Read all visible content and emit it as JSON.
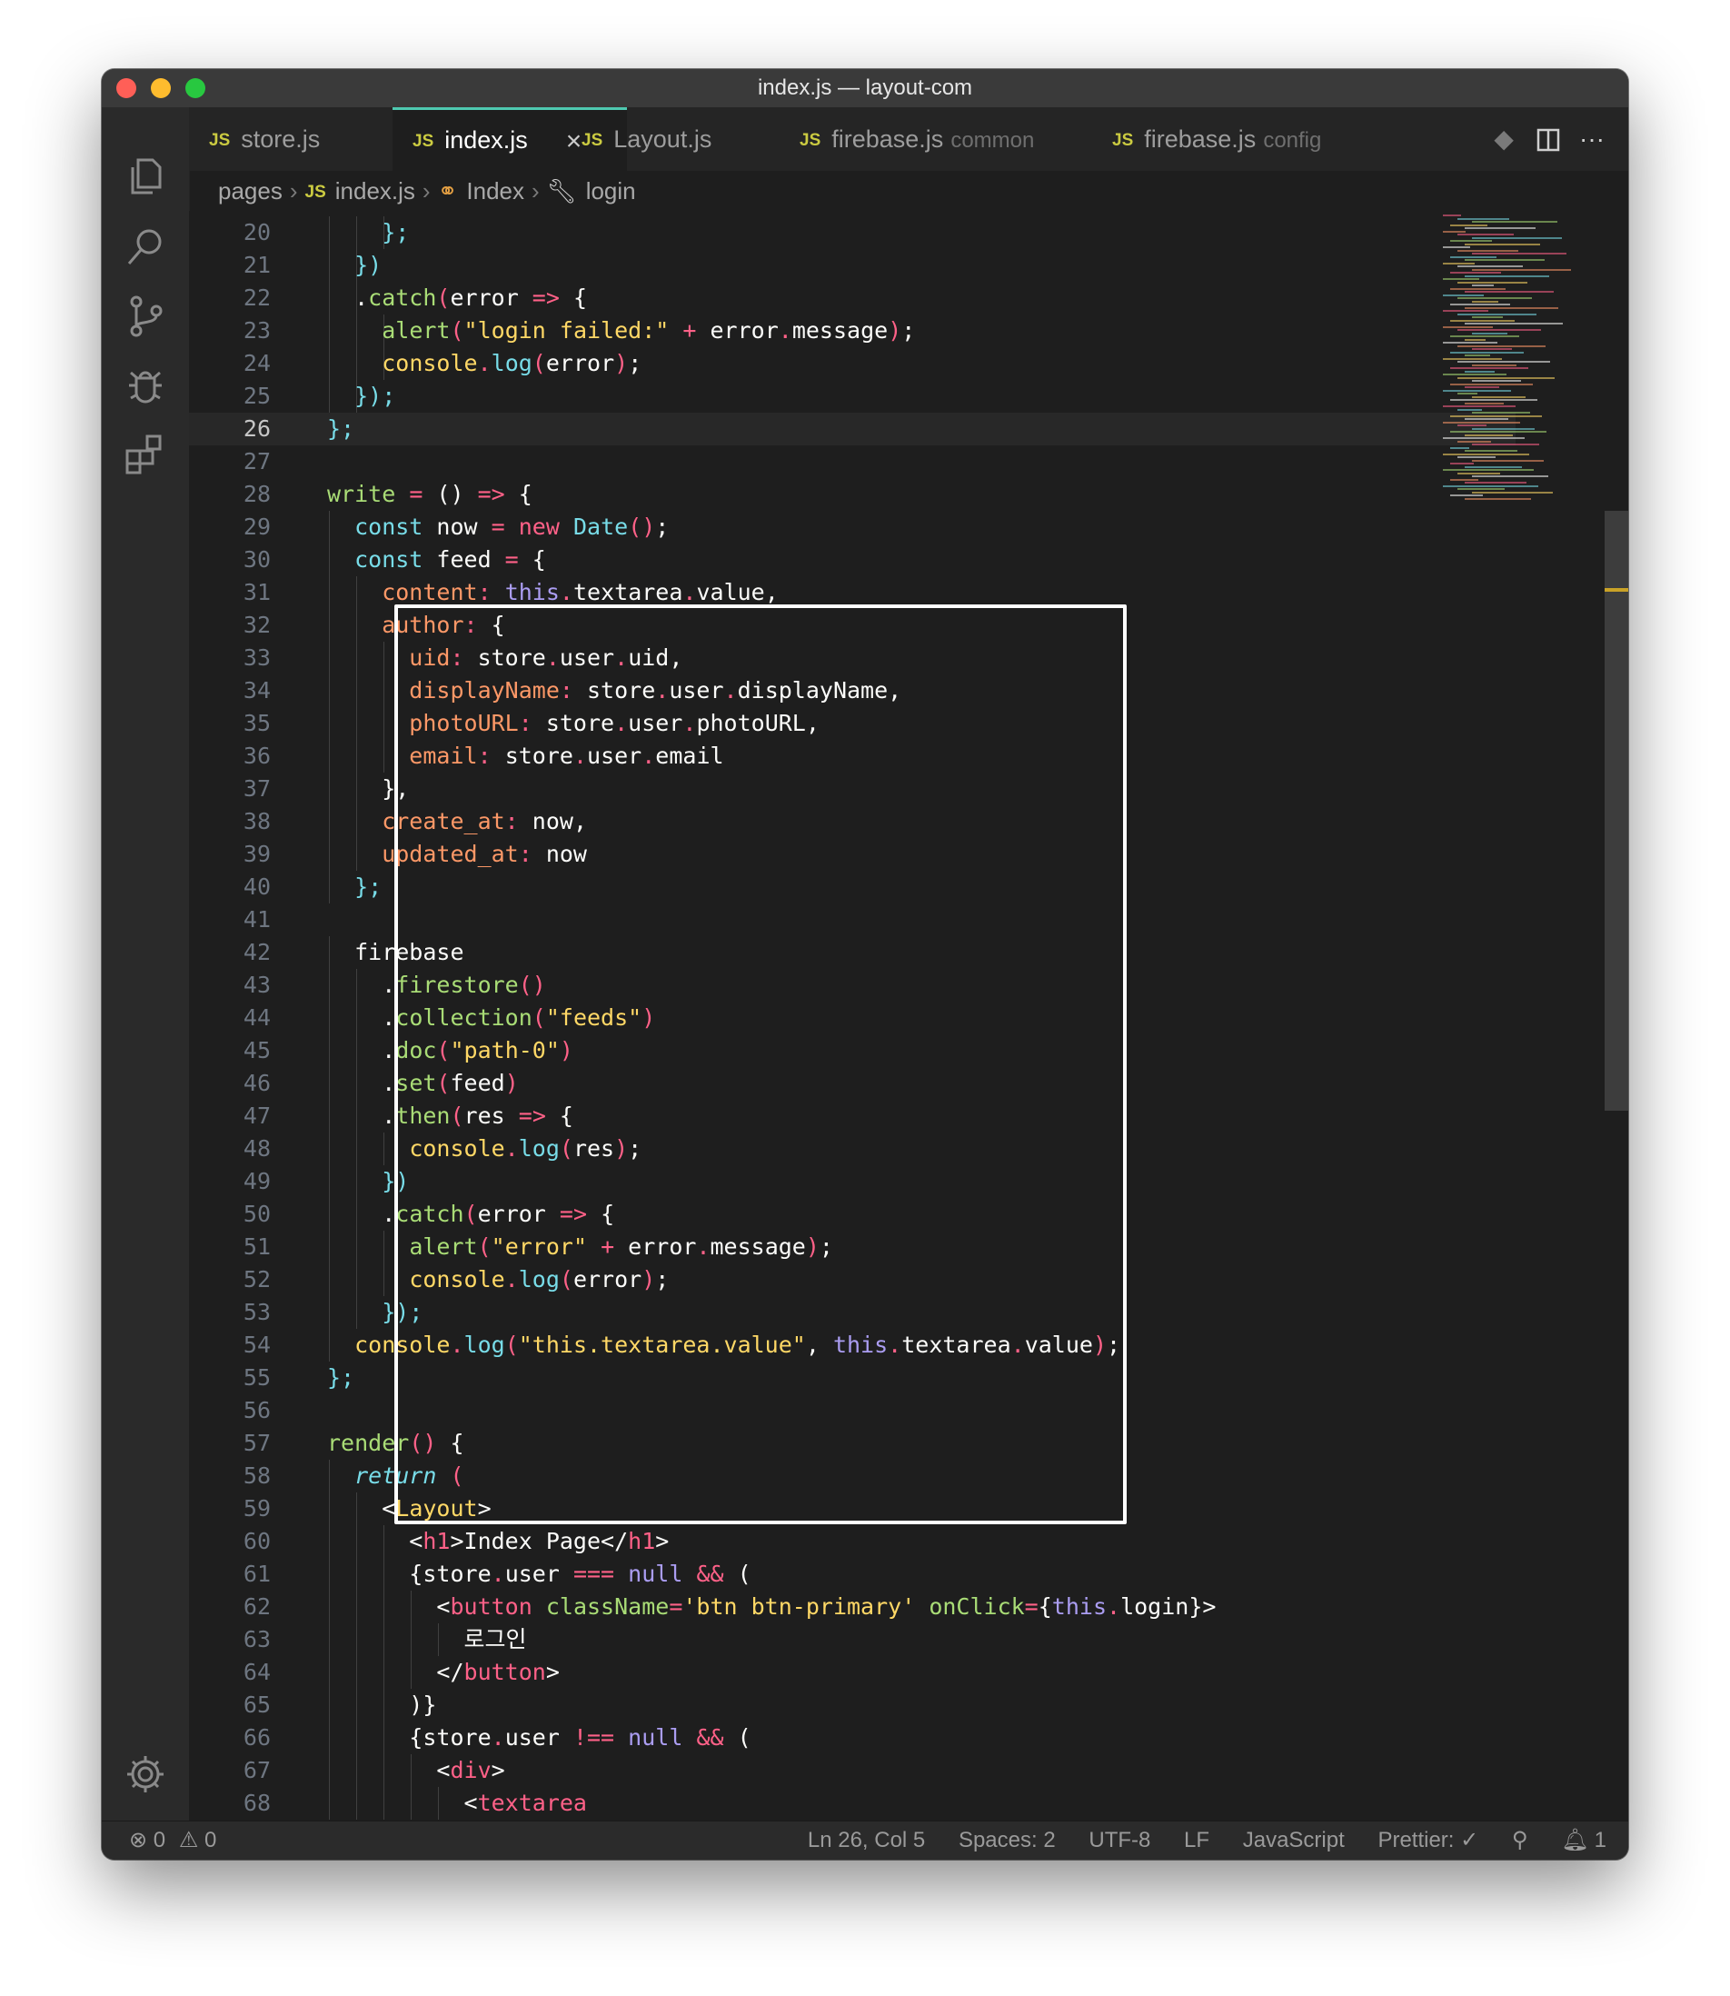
{
  "window": {
    "title": "index.js — layout-com"
  },
  "activity_bar": {
    "items": [
      "explorer-icon",
      "search-icon",
      "source-control-icon",
      "debug-icon",
      "extensions-icon"
    ],
    "bottom": "gear-icon"
  },
  "tabs": [
    {
      "badge": "JS",
      "label": "store.js",
      "desc": "",
      "active": false
    },
    {
      "badge": "JS",
      "label": "index.js",
      "desc": "",
      "active": true,
      "close": "×"
    },
    {
      "badge": "JS",
      "label": "Layout.js",
      "desc": "",
      "active": false
    },
    {
      "badge": "JS",
      "label": "firebase.js",
      "desc": "common",
      "active": false
    },
    {
      "badge": "JS",
      "label": "firebase.js",
      "desc": "config",
      "active": false
    }
  ],
  "tab_actions": [
    "source-diff-icon",
    "split-editor-icon",
    "more-actions-icon"
  ],
  "breadcrumb": {
    "folder": "pages",
    "file_badge": "JS",
    "file": "index.js",
    "class": "Index",
    "method": "login"
  },
  "editor": {
    "current_line": 26,
    "lines": [
      {
        "n": "20",
        "indent": 3,
        "t": [
          [
            "p",
            "    "
          ],
          [
            "k",
            "};"
          ]
        ]
      },
      {
        "n": "21",
        "indent": 2,
        "t": [
          [
            "k",
            "  })"
          ]
        ]
      },
      {
        "n": "22",
        "indent": 2,
        "t": [
          [
            "w",
            "  ."
          ],
          [
            "g",
            "catch"
          ],
          [
            "p",
            "("
          ],
          [
            "w",
            "error "
          ],
          [
            "p",
            "=>"
          ],
          [
            "w",
            " {"
          ]
        ]
      },
      {
        "n": "23",
        "indent": 3,
        "t": [
          [
            "w",
            "    "
          ],
          [
            "g",
            "alert"
          ],
          [
            "p",
            "("
          ],
          [
            "y",
            "\"login failed:\""
          ],
          [
            "w",
            " "
          ],
          [
            "p",
            "+"
          ],
          [
            "w",
            " error"
          ],
          [
            "p",
            "."
          ],
          [
            "w",
            "message"
          ],
          [
            "p",
            ")"
          ],
          [
            "w",
            ";"
          ]
        ]
      },
      {
        "n": "24",
        "indent": 3,
        "t": [
          [
            "w",
            "    "
          ],
          [
            "y",
            "console"
          ],
          [
            "p",
            "."
          ],
          [
            "k",
            "log"
          ],
          [
            "p",
            "("
          ],
          [
            "w",
            "error"
          ],
          [
            "p",
            ")"
          ],
          [
            "w",
            ";"
          ]
        ]
      },
      {
        "n": "25",
        "indent": 2,
        "t": [
          [
            "k",
            "  });"
          ]
        ]
      },
      {
        "n": "26",
        "indent": 0,
        "t": [
          [
            "k",
            "};"
          ]
        ]
      },
      {
        "n": "27",
        "indent": 0,
        "t": []
      },
      {
        "n": "28",
        "indent": 0,
        "t": [
          [
            "g",
            "write"
          ],
          [
            "w",
            " "
          ],
          [
            "p",
            "="
          ],
          [
            "w",
            " () "
          ],
          [
            "p",
            "=>"
          ],
          [
            "w",
            " {"
          ]
        ]
      },
      {
        "n": "29",
        "indent": 1,
        "t": [
          [
            "k",
            "  const"
          ],
          [
            "w",
            " now "
          ],
          [
            "p",
            "="
          ],
          [
            "w",
            " "
          ],
          [
            "p",
            "new"
          ],
          [
            "w",
            " "
          ],
          [
            "k",
            "Date"
          ],
          [
            "p",
            "()"
          ],
          [
            "w",
            ";"
          ]
        ]
      },
      {
        "n": "30",
        "indent": 1,
        "t": [
          [
            "k",
            "  const"
          ],
          [
            "w",
            " feed "
          ],
          [
            "p",
            "="
          ],
          [
            "w",
            " {"
          ]
        ]
      },
      {
        "n": "31",
        "indent": 2,
        "t": [
          [
            "o",
            "    content"
          ],
          [
            "p",
            ":"
          ],
          [
            "w",
            " "
          ],
          [
            "pl",
            "this"
          ],
          [
            "p",
            "."
          ],
          [
            "w",
            "textarea"
          ],
          [
            "p",
            "."
          ],
          [
            "w",
            "value,"
          ]
        ]
      },
      {
        "n": "32",
        "indent": 2,
        "t": [
          [
            "o",
            "    author"
          ],
          [
            "p",
            ":"
          ],
          [
            "w",
            " {"
          ]
        ]
      },
      {
        "n": "33",
        "indent": 3,
        "t": [
          [
            "o",
            "      uid"
          ],
          [
            "p",
            ":"
          ],
          [
            "w",
            " store"
          ],
          [
            "p",
            "."
          ],
          [
            "w",
            "user"
          ],
          [
            "p",
            "."
          ],
          [
            "w",
            "uid,"
          ]
        ]
      },
      {
        "n": "34",
        "indent": 3,
        "t": [
          [
            "o",
            "      displayName"
          ],
          [
            "p",
            ":"
          ],
          [
            "w",
            " store"
          ],
          [
            "p",
            "."
          ],
          [
            "w",
            "user"
          ],
          [
            "p",
            "."
          ],
          [
            "w",
            "displayName,"
          ]
        ]
      },
      {
        "n": "35",
        "indent": 3,
        "t": [
          [
            "o",
            "      photoURL"
          ],
          [
            "p",
            ":"
          ],
          [
            "w",
            " store"
          ],
          [
            "p",
            "."
          ],
          [
            "w",
            "user"
          ],
          [
            "p",
            "."
          ],
          [
            "w",
            "photoURL,"
          ]
        ]
      },
      {
        "n": "36",
        "indent": 3,
        "t": [
          [
            "o",
            "      email"
          ],
          [
            "p",
            ":"
          ],
          [
            "w",
            " store"
          ],
          [
            "p",
            "."
          ],
          [
            "w",
            "user"
          ],
          [
            "p",
            "."
          ],
          [
            "w",
            "email"
          ]
        ]
      },
      {
        "n": "37",
        "indent": 2,
        "t": [
          [
            "w",
            "    },"
          ]
        ]
      },
      {
        "n": "38",
        "indent": 2,
        "t": [
          [
            "o",
            "    create_at"
          ],
          [
            "p",
            ":"
          ],
          [
            "w",
            " now,"
          ]
        ]
      },
      {
        "n": "39",
        "indent": 2,
        "t": [
          [
            "o",
            "    updated_at"
          ],
          [
            "p",
            ":"
          ],
          [
            "w",
            " now"
          ]
        ]
      },
      {
        "n": "40",
        "indent": 1,
        "t": [
          [
            "k",
            "  };"
          ]
        ]
      },
      {
        "n": "41",
        "indent": 0,
        "t": []
      },
      {
        "n": "42",
        "indent": 1,
        "t": [
          [
            "w",
            "  firebase"
          ]
        ]
      },
      {
        "n": "43",
        "indent": 2,
        "t": [
          [
            "w",
            "    ."
          ],
          [
            "g",
            "firestore"
          ],
          [
            "p",
            "()"
          ]
        ]
      },
      {
        "n": "44",
        "indent": 2,
        "t": [
          [
            "w",
            "    ."
          ],
          [
            "g",
            "collection"
          ],
          [
            "p",
            "("
          ],
          [
            "y",
            "\"feeds\""
          ],
          [
            "p",
            ")"
          ]
        ]
      },
      {
        "n": "45",
        "indent": 2,
        "t": [
          [
            "w",
            "    ."
          ],
          [
            "g",
            "doc"
          ],
          [
            "p",
            "("
          ],
          [
            "y",
            "\"path-0\""
          ],
          [
            "p",
            ")"
          ]
        ]
      },
      {
        "n": "46",
        "indent": 2,
        "t": [
          [
            "w",
            "    ."
          ],
          [
            "g",
            "set"
          ],
          [
            "p",
            "("
          ],
          [
            "w",
            "feed"
          ],
          [
            "p",
            ")"
          ]
        ]
      },
      {
        "n": "47",
        "indent": 2,
        "t": [
          [
            "w",
            "    ."
          ],
          [
            "g",
            "then"
          ],
          [
            "p",
            "("
          ],
          [
            "w",
            "res "
          ],
          [
            "p",
            "=>"
          ],
          [
            "w",
            " {"
          ]
        ]
      },
      {
        "n": "48",
        "indent": 3,
        "t": [
          [
            "w",
            "      "
          ],
          [
            "y",
            "console"
          ],
          [
            "p",
            "."
          ],
          [
            "k",
            "log"
          ],
          [
            "p",
            "("
          ],
          [
            "w",
            "res"
          ],
          [
            "p",
            ")"
          ],
          [
            "w",
            ";"
          ]
        ]
      },
      {
        "n": "49",
        "indent": 2,
        "t": [
          [
            "k",
            "    })"
          ]
        ]
      },
      {
        "n": "50",
        "indent": 2,
        "t": [
          [
            "w",
            "    ."
          ],
          [
            "g",
            "catch"
          ],
          [
            "p",
            "("
          ],
          [
            "w",
            "error "
          ],
          [
            "p",
            "=>"
          ],
          [
            "w",
            " {"
          ]
        ]
      },
      {
        "n": "51",
        "indent": 3,
        "t": [
          [
            "w",
            "      "
          ],
          [
            "g",
            "alert"
          ],
          [
            "p",
            "("
          ],
          [
            "y",
            "\"error\""
          ],
          [
            "w",
            " "
          ],
          [
            "p",
            "+"
          ],
          [
            "w",
            " error"
          ],
          [
            "p",
            "."
          ],
          [
            "w",
            "message"
          ],
          [
            "p",
            ")"
          ],
          [
            "w",
            ";"
          ]
        ]
      },
      {
        "n": "52",
        "indent": 3,
        "t": [
          [
            "w",
            "      "
          ],
          [
            "y",
            "console"
          ],
          [
            "p",
            "."
          ],
          [
            "k",
            "log"
          ],
          [
            "p",
            "("
          ],
          [
            "w",
            "error"
          ],
          [
            "p",
            ")"
          ],
          [
            "w",
            ";"
          ]
        ]
      },
      {
        "n": "53",
        "indent": 2,
        "t": [
          [
            "k",
            "    });"
          ]
        ]
      },
      {
        "n": "54",
        "indent": 1,
        "t": [
          [
            "y",
            "  console"
          ],
          [
            "p",
            "."
          ],
          [
            "k",
            "log"
          ],
          [
            "p",
            "("
          ],
          [
            "y",
            "\"this.textarea.value\""
          ],
          [
            "w",
            ", "
          ],
          [
            "pl",
            "this"
          ],
          [
            "p",
            "."
          ],
          [
            "w",
            "textarea"
          ],
          [
            "p",
            "."
          ],
          [
            "w",
            "value"
          ],
          [
            "p",
            ")"
          ],
          [
            "w",
            ";"
          ]
        ]
      },
      {
        "n": "55",
        "indent": 0,
        "t": [
          [
            "k",
            "};"
          ]
        ]
      },
      {
        "n": "56",
        "indent": 0,
        "t": []
      },
      {
        "n": "57",
        "indent": 0,
        "t": [
          [
            "g",
            "render"
          ],
          [
            "p",
            "()"
          ],
          [
            "w",
            " {"
          ]
        ]
      },
      {
        "n": "58",
        "indent": 1,
        "t": [
          [
            "it",
            "  return"
          ],
          [
            "w",
            " "
          ],
          [
            "p",
            "("
          ]
        ]
      },
      {
        "n": "59",
        "indent": 2,
        "t": [
          [
            "w",
            "    <"
          ],
          [
            "y",
            "Layout"
          ],
          [
            "w",
            ">"
          ]
        ]
      },
      {
        "n": "60",
        "indent": 3,
        "t": [
          [
            "w",
            "      <"
          ],
          [
            "p",
            "h1"
          ],
          [
            "w",
            ">Index Page</"
          ],
          [
            "p",
            "h1"
          ],
          [
            "w",
            ">"
          ]
        ]
      },
      {
        "n": "61",
        "indent": 3,
        "t": [
          [
            "w",
            "      {store"
          ],
          [
            "p",
            "."
          ],
          [
            "w",
            "user "
          ],
          [
            "p",
            "==="
          ],
          [
            "w",
            " "
          ],
          [
            "pl",
            "null"
          ],
          [
            "w",
            " "
          ],
          [
            "p",
            "&&"
          ],
          [
            "w",
            " ("
          ]
        ]
      },
      {
        "n": "62",
        "indent": 4,
        "t": [
          [
            "w",
            "        <"
          ],
          [
            "p",
            "button"
          ],
          [
            "w",
            " "
          ],
          [
            "g",
            "className"
          ],
          [
            "p",
            "="
          ],
          [
            "y",
            "'btn btn-primary'"
          ],
          [
            "w",
            " "
          ],
          [
            "g",
            "onClick"
          ],
          [
            "p",
            "="
          ],
          [
            "w",
            "{"
          ],
          [
            "pl",
            "this"
          ],
          [
            "p",
            "."
          ],
          [
            "w",
            "login}>"
          ]
        ]
      },
      {
        "n": "63",
        "indent": 5,
        "t": [
          [
            "w",
            "          로그인"
          ]
        ]
      },
      {
        "n": "64",
        "indent": 4,
        "t": [
          [
            "w",
            "        </"
          ],
          [
            "p",
            "button"
          ],
          [
            "w",
            ">"
          ]
        ]
      },
      {
        "n": "65",
        "indent": 3,
        "t": [
          [
            "w",
            "      )}"
          ]
        ]
      },
      {
        "n": "66",
        "indent": 3,
        "t": [
          [
            "w",
            "      {store"
          ],
          [
            "p",
            "."
          ],
          [
            "w",
            "user "
          ],
          [
            "p",
            "!=="
          ],
          [
            "w",
            " "
          ],
          [
            "pl",
            "null"
          ],
          [
            "w",
            " "
          ],
          [
            "p",
            "&&"
          ],
          [
            "w",
            " ("
          ]
        ]
      },
      {
        "n": "67",
        "indent": 4,
        "t": [
          [
            "w",
            "        <"
          ],
          [
            "p",
            "div"
          ],
          [
            "w",
            ">"
          ]
        ]
      },
      {
        "n": "68",
        "indent": 5,
        "t": [
          [
            "w",
            "          <"
          ],
          [
            "p",
            "textarea"
          ]
        ]
      }
    ]
  },
  "status_bar": {
    "errors_icon": "error-icon",
    "errors": "0",
    "warnings_icon": "warning-icon",
    "warnings": "0",
    "position": "Ln 26, Col 5",
    "spaces": "Spaces: 2",
    "encoding": "UTF-8",
    "eol": "LF",
    "language": "JavaScript",
    "formatter": "Prettier: ✓",
    "feedback_icon": "feedback-icon",
    "bell_icon": "bell-icon",
    "notifications": "1"
  }
}
